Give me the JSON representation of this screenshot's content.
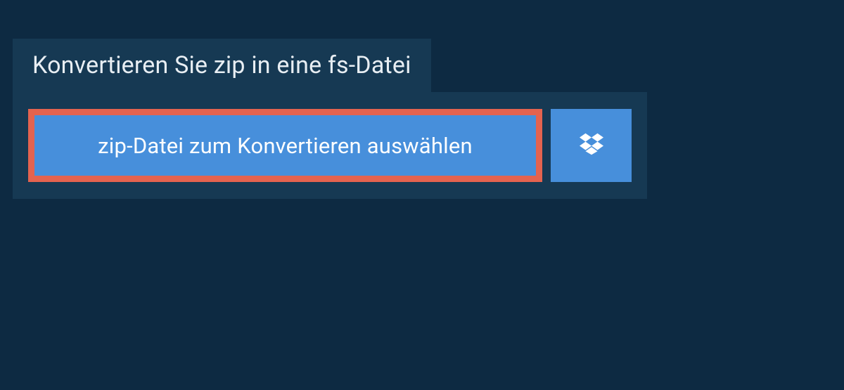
{
  "converter": {
    "title": "Konvertieren Sie zip in eine fs-Datei",
    "select_button_label": "zip-Datei zum Konvertieren auswählen"
  },
  "colors": {
    "background": "#0d2a42",
    "panel": "#163953",
    "button": "#478fdb",
    "highlight_border": "#e4634f",
    "text_light": "#ffffff"
  }
}
